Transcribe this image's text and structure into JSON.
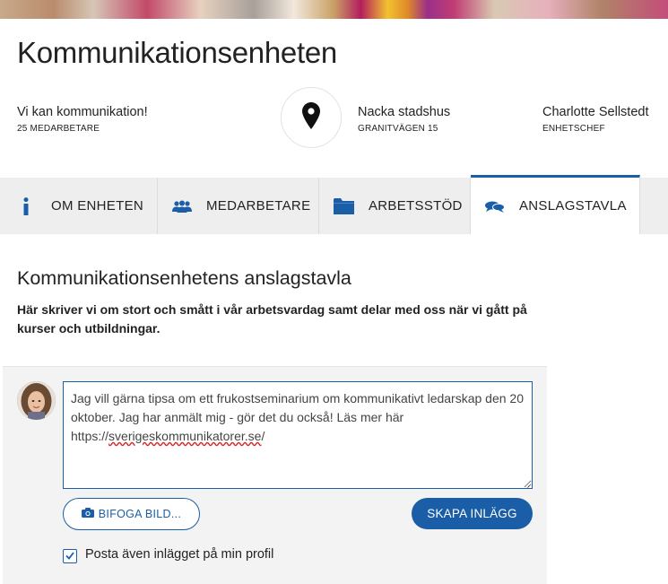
{
  "unit": {
    "title": "Kommunikationsenheten",
    "motto": "Vi kan kommunikation!",
    "member_count": "25 MEDARBETARE",
    "location_name": "Nacka stadshus",
    "location_address": "GRANITVÄGEN 15",
    "manager_name": "Charlotte Sellstedt",
    "manager_role": "ENHETSCHEF"
  },
  "tabs": [
    {
      "label": "OM ENHETEN",
      "icon": "info-icon"
    },
    {
      "label": "MEDARBETARE",
      "icon": "people-icon"
    },
    {
      "label": "ARBETSSTÖD",
      "icon": "folder-icon"
    },
    {
      "label": "ANSLAGSTAVLA",
      "icon": "speech-bubbles-icon",
      "active": true
    }
  ],
  "board": {
    "title": "Kommunikationsenhetens anslagstavla",
    "description": "Här skriver vi om stort och smått i vår arbetsvardag samt delar med oss när vi gått på kurser och utbildningar."
  },
  "composer": {
    "text_before_link": "Jag vill gärna tipsa om ett frukostseminarium om kommunikativt ledarskap den 20 oktober. Jag har anmält mig - gör det du också! Läs mer här https://",
    "link_text": "sverigeskommunikatorer.se",
    "text_after_link": "/",
    "attach_label": "BIFOGA BILD...",
    "submit_label": "SKAPA INLÄGG",
    "checkbox_label": "Posta även inlägget på min profil",
    "checkbox_checked": true
  },
  "colors": {
    "accent": "#1b5ea8",
    "tab_bar": "#eeeeee",
    "composer_bg": "#f3f3f3"
  }
}
